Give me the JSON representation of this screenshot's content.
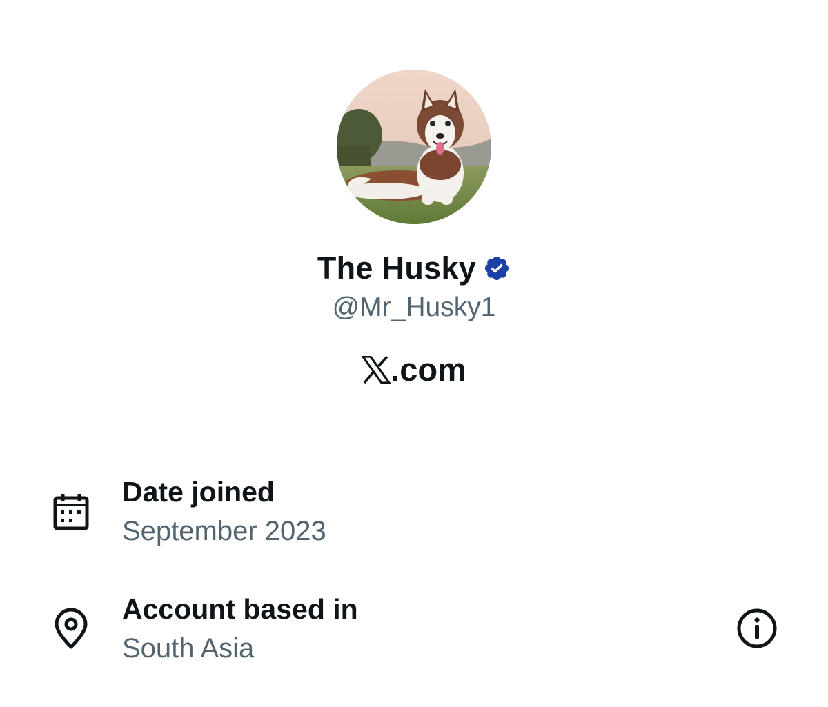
{
  "profile": {
    "display_name": "The Husky",
    "handle": "@Mr_Husky1",
    "verified": true,
    "site": ".com",
    "avatar_icon": "husky-photo-avatar",
    "verified_color": "#1d3fa8"
  },
  "details": {
    "date_joined": {
      "icon": "calendar-icon",
      "label": "Date joined",
      "value": "September 2023"
    },
    "location": {
      "icon": "location-pin-icon",
      "label": "Account based in",
      "value": "South Asia",
      "info_icon": "info-icon"
    }
  },
  "colors": {
    "primary_text": "#0f1419",
    "secondary_text": "#536471"
  }
}
